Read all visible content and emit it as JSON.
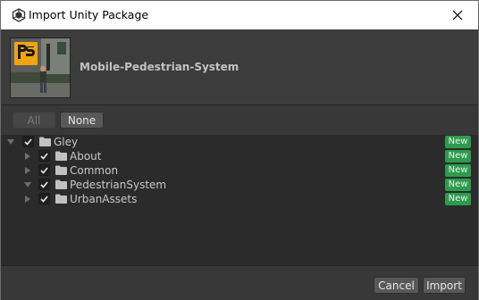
{
  "window": {
    "title": "Import Unity Package"
  },
  "package": {
    "name": "Mobile-Pedestrian-System",
    "thumbnail_logo_text": "PS"
  },
  "filter": {
    "all_label": "All",
    "none_label": "None"
  },
  "tree": {
    "items": [
      {
        "label": "Gley",
        "checked": true,
        "expanded": true,
        "level": 0,
        "badge": "New"
      },
      {
        "label": "About",
        "checked": true,
        "expanded": false,
        "level": 1,
        "badge": "New"
      },
      {
        "label": "Common",
        "checked": true,
        "expanded": false,
        "level": 1,
        "badge": "New"
      },
      {
        "label": "PedestrianSystem",
        "checked": true,
        "expanded": true,
        "level": 1,
        "badge": "New"
      },
      {
        "label": "UrbanAssets",
        "checked": true,
        "expanded": false,
        "level": 1,
        "badge": "New"
      }
    ]
  },
  "footer": {
    "cancel_label": "Cancel",
    "import_label": "Import"
  },
  "colors": {
    "badge_green": "#2d9b4e",
    "panel_dark": "#2b2b2b",
    "panel": "#383838"
  }
}
